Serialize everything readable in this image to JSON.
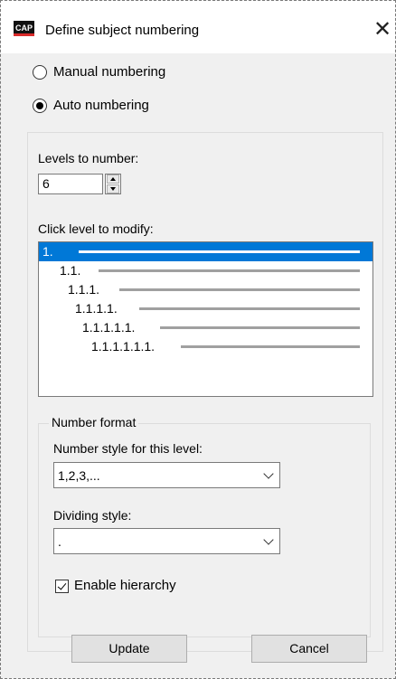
{
  "window": {
    "title": "Define subject numbering",
    "app_icon_text": "CAP",
    "close_glyph": "✕"
  },
  "numbering_mode": {
    "manual_label": "Manual numbering",
    "auto_label": "Auto numbering",
    "selected": "auto"
  },
  "levels": {
    "label": "Levels to number:",
    "value": "6"
  },
  "level_list": {
    "label": "Click level to modify:",
    "items": [
      "1.",
      "1.1.",
      "1.1.1.",
      "1.1.1.1.",
      "1.1.1.1.1.",
      "1.1.1.1.1.1."
    ],
    "selected_index": 0
  },
  "number_format": {
    "group_label": "Number format",
    "style_label": "Number style for this level:",
    "style_value": "1,2,3,...",
    "dividing_label": "Dividing style:",
    "dividing_value": ".",
    "hierarchy_label": "Enable hierarchy",
    "hierarchy_checked": true
  },
  "buttons": {
    "update": "Update",
    "cancel": "Cancel"
  },
  "colors": {
    "selection": "#0078d7",
    "level_line": "#a0a0a0",
    "dialog_bg": "#f0f0f0"
  }
}
